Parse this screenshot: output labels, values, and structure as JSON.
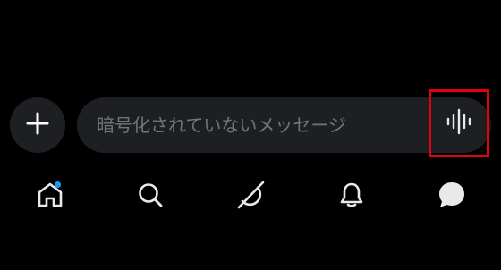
{
  "composer": {
    "add_icon": "plus-icon",
    "input": {
      "placeholder": "暗号化されていないメッセージ",
      "value": ""
    },
    "voice_icon": "waveform-icon",
    "highlight_color": "#e4000f"
  },
  "tabbar": {
    "items": [
      {
        "id": "home",
        "icon": "home-icon",
        "has_notification_dot": true
      },
      {
        "id": "search",
        "icon": "search-icon",
        "has_notification_dot": false
      },
      {
        "id": "grok",
        "icon": "grok-icon",
        "has_notification_dot": false
      },
      {
        "id": "notifications",
        "icon": "bell-icon",
        "has_notification_dot": false
      },
      {
        "id": "messages",
        "icon": "message-icon",
        "has_notification_dot": false
      }
    ],
    "dot_color": "#1d9bf0"
  }
}
